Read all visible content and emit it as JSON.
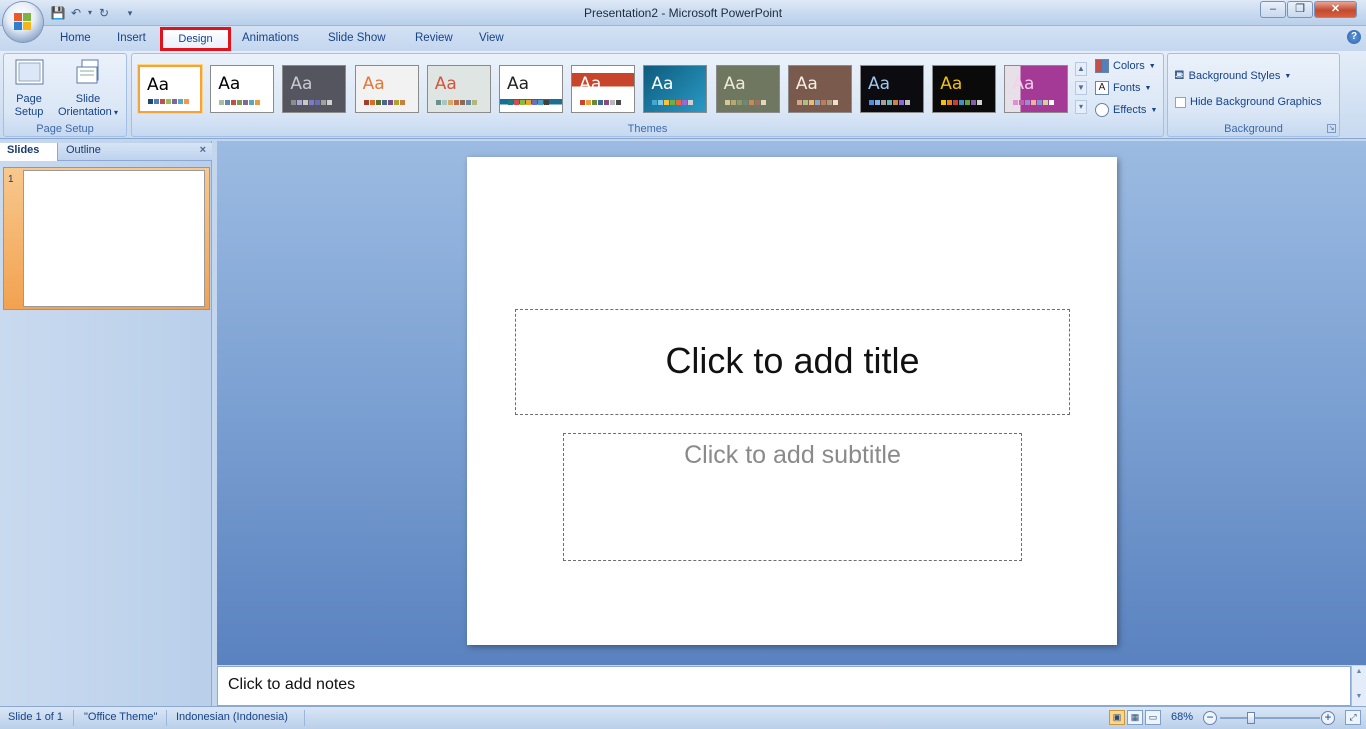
{
  "window": {
    "title": "Presentation2 - Microsoft PowerPoint",
    "minimize": "–",
    "maximize": "❐",
    "close": "✕"
  },
  "qat": {
    "save_icon": "💾",
    "undo_icon": "↶",
    "redo_icon": "↻",
    "customize_icon": "▾"
  },
  "tabs": [
    "Home",
    "Insert",
    "Design",
    "Animations",
    "Slide Show",
    "Review",
    "View"
  ],
  "active_tab": "Design",
  "ribbon": {
    "page_setup": {
      "page_setup_label_1": "Page",
      "page_setup_label_2": "Setup",
      "slide_orientation_label_1": "Slide",
      "slide_orientation_label_2": "Orientation",
      "group_label": "Page Setup"
    },
    "themes": {
      "group_label": "Themes",
      "sample_text": "Aa",
      "items": [
        {
          "bg": "#ffffff",
          "fg": "#000000",
          "selected": true,
          "colors": [
            "#1f497d",
            "#4f81bd",
            "#c0504d",
            "#9bbb59",
            "#8064a2",
            "#4bacc6",
            "#f79646"
          ]
        },
        {
          "bg": "#ffffff",
          "fg": "#000000",
          "selected": false,
          "colors": [
            "#a9bda3",
            "#5d8aa8",
            "#bf5048",
            "#7f9752",
            "#84669a",
            "#5fa5b9",
            "#e89b40"
          ]
        },
        {
          "bg": "#55555f",
          "fg": "#c9c9d2",
          "selected": false,
          "colors": [
            "#8c8c8c",
            "#a8a8d8",
            "#c8c8c8",
            "#7b7bc8",
            "#6b6bb8",
            "#a0a0a0",
            "#d0d0d0"
          ]
        },
        {
          "bg": "#f2f2f2",
          "fg": "#e2773b",
          "selected": false,
          "colors": [
            "#a33e2a",
            "#d36f2a",
            "#5f6f2f",
            "#4a6a8a",
            "#7a4b8a",
            "#b0a030",
            "#c88040"
          ]
        },
        {
          "bg": "#dfe5e3",
          "fg": "#d2563a",
          "selected": false,
          "colors": [
            "#6b8f8e",
            "#a8c4c3",
            "#d3a86a",
            "#c26c4a",
            "#8a6b5a",
            "#6a8aa4",
            "#b0b87a"
          ]
        },
        {
          "bg": "#ffffff",
          "fg": "#222222",
          "selected": false,
          "colors": [
            "#1a7b8a",
            "#d04f4f",
            "#8bb83e",
            "#e6a832",
            "#6f6fb8",
            "#48a0c8",
            "#404040"
          ]
        },
        {
          "bg": "#ffffff",
          "fg": "#ffffff",
          "selected": false,
          "colors": [
            "#c8442a",
            "#e9a13b",
            "#6a8a3a",
            "#3a6a9a",
            "#8a4a7a",
            "#b8b8b8",
            "#4a4a4a"
          ]
        },
        {
          "bg": "#1a6d93",
          "fg": "#ffffff",
          "selected": false,
          "colors": [
            "#42a8d6",
            "#7ec8e8",
            "#f2c440",
            "#6ab04c",
            "#e36c3c",
            "#9a6ad0",
            "#d0d0d0"
          ]
        },
        {
          "bg": "#6f7760",
          "fg": "#f0ecd8",
          "selected": false,
          "colors": [
            "#d8c890",
            "#b8a870",
            "#8a9a68",
            "#6a8a78",
            "#c88a50",
            "#a07060",
            "#e0d8b8"
          ]
        },
        {
          "bg": "#7a5a4c",
          "fg": "#f3eee6",
          "selected": false,
          "colors": [
            "#d0a888",
            "#a8c088",
            "#e0c078",
            "#88a8c0",
            "#c07a60",
            "#a89a80",
            "#f0e0c8"
          ]
        },
        {
          "bg": "#0b0b10",
          "fg": "#9fc8f0",
          "selected": false,
          "colors": [
            "#4f8fd8",
            "#7fb0e8",
            "#a0a0a0",
            "#6ab0b0",
            "#d08040",
            "#8a6ad0",
            "#c0c0c0"
          ]
        },
        {
          "bg": "#0a0a0a",
          "fg": "#f2c200",
          "selected": false,
          "colors": [
            "#f2c200",
            "#e08020",
            "#c04040",
            "#4090c0",
            "#60a040",
            "#8060a0",
            "#d0d0d0"
          ]
        },
        {
          "bg": "#a43a95",
          "fg": "#f4d0ea",
          "selected": false,
          "colors": [
            "#e090d0",
            "#c060b0",
            "#9a8ad0",
            "#f0b0a0",
            "#70a0d0",
            "#d0d0a0",
            "#ffffff"
          ]
        }
      ]
    },
    "theme_options": {
      "colors": "Colors",
      "fonts": "Fonts",
      "effects": "Effects"
    },
    "background": {
      "styles": "Background Styles",
      "hide_graphics": "Hide Background Graphics",
      "group_label": "Background"
    }
  },
  "panel": {
    "slides_tab": "Slides",
    "outline_tab": "Outline",
    "close_icon": "×",
    "slide_number": "1"
  },
  "slide": {
    "title_placeholder": "Click to add title",
    "subtitle_placeholder": "Click to add subtitle"
  },
  "notes": {
    "placeholder": "Click to add notes"
  },
  "status": {
    "slide_info": "Slide 1 of 1",
    "theme": "\"Office Theme\"",
    "language": "Indonesian (Indonesia)",
    "zoom": "68%",
    "zoom_out": "−",
    "zoom_in": "+"
  },
  "colors": {
    "highlight_red": "#e1121b",
    "ribbon_text": "#15428b"
  }
}
